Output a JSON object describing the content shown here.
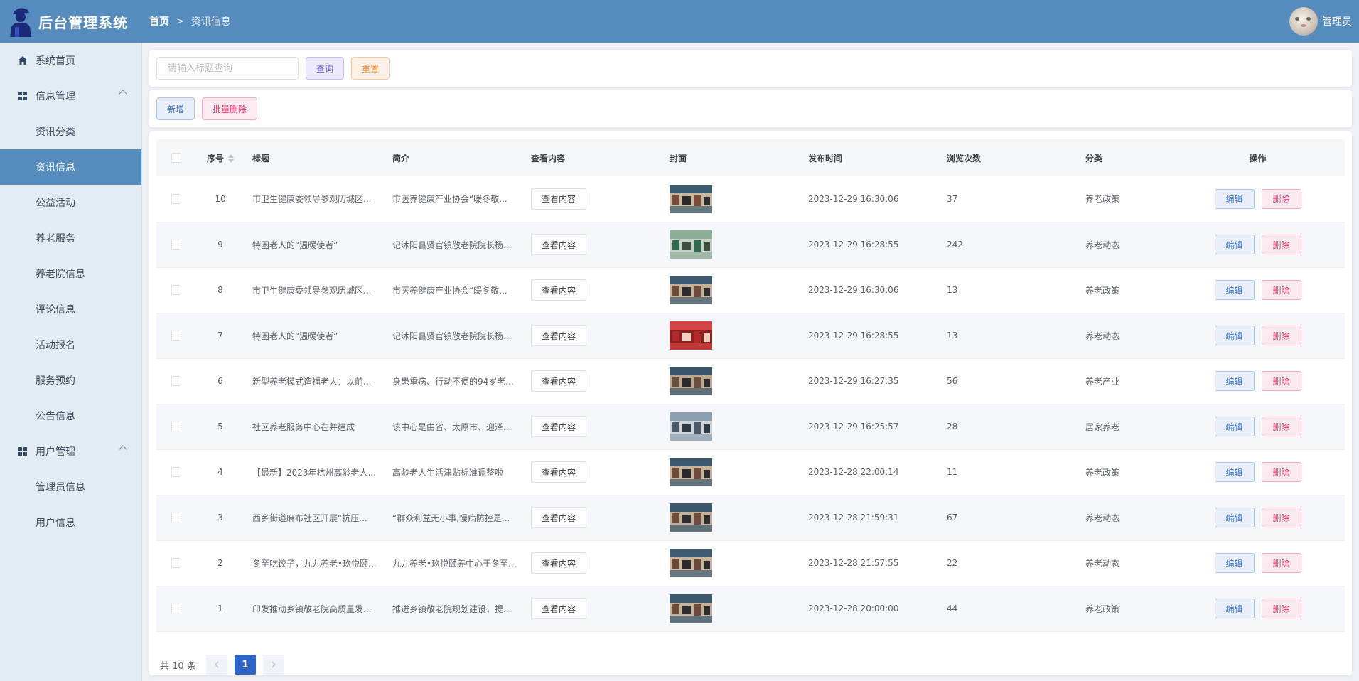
{
  "app": {
    "title": "后台管理系统"
  },
  "breadcrumb": {
    "home": "首页",
    "separator": ">",
    "current": "资讯信息"
  },
  "user": {
    "name": "管理员"
  },
  "sidebar": {
    "items": [
      {
        "label": "系统首页",
        "icon": "home-icon",
        "type": "top"
      },
      {
        "label": "信息管理",
        "icon": "grid-icon",
        "type": "group"
      },
      {
        "label": "资讯分类",
        "type": "sub"
      },
      {
        "label": "资讯信息",
        "type": "sub",
        "active": true
      },
      {
        "label": "公益活动",
        "type": "sub"
      },
      {
        "label": "养老服务",
        "type": "sub"
      },
      {
        "label": "养老院信息",
        "type": "sub"
      },
      {
        "label": "评论信息",
        "type": "sub"
      },
      {
        "label": "活动报名",
        "type": "sub"
      },
      {
        "label": "服务预约",
        "type": "sub"
      },
      {
        "label": "公告信息",
        "type": "sub"
      },
      {
        "label": "用户管理",
        "icon": "grid-icon",
        "type": "group"
      },
      {
        "label": "管理员信息",
        "type": "sub"
      },
      {
        "label": "用户信息",
        "type": "sub"
      }
    ]
  },
  "search": {
    "placeholder": "请输入标题查询",
    "value": "",
    "query_label": "查询",
    "reset_label": "重置"
  },
  "actions": {
    "add_label": "新增",
    "batch_delete_label": "批量删除"
  },
  "table": {
    "columns": [
      "序号",
      "标题",
      "简介",
      "查看内容",
      "封面",
      "发布时间",
      "浏览次数",
      "分类",
      "操作"
    ],
    "view_label": "查看内容",
    "edit_label": "编辑",
    "delete_label": "删除",
    "rows": [
      {
        "id": "10",
        "title": "市卫生健康委领导参观历城区...",
        "intro": "市医养健康产业协会“暖冬敬...",
        "time": "2023-12-29 16:30:06",
        "views": "37",
        "category": "养老政策"
      },
      {
        "id": "9",
        "title": "特困老人的“温暖使者”",
        "intro": "记沭阳县贤官镇敬老院院长杨...",
        "time": "2023-12-29 16:28:55",
        "views": "242",
        "category": "养老动态"
      },
      {
        "id": "8",
        "title": "市卫生健康委领导参观历城区...",
        "intro": "市医养健康产业协会“暖冬敬...",
        "time": "2023-12-29 16:30:06",
        "views": "13",
        "category": "养老政策"
      },
      {
        "id": "7",
        "title": "特困老人的“温暖使者”",
        "intro": "记沭阳县贤官镇敬老院院长杨...",
        "time": "2023-12-29 16:28:55",
        "views": "13",
        "category": "养老动态"
      },
      {
        "id": "6",
        "title": "新型养老模式造福老人：以前...",
        "intro": "身患重病、行动不便的94岁老...",
        "time": "2023-12-29 16:27:35",
        "views": "56",
        "category": "养老产业"
      },
      {
        "id": "5",
        "title": "社区养老服务中心在并建成",
        "intro": "该中心是由省、太原市、迎泽...",
        "time": "2023-12-29 16:25:57",
        "views": "28",
        "category": "居家养老"
      },
      {
        "id": "4",
        "title": "【最新】2023年杭州高龄老人...",
        "intro": "高龄老人生活津贴标准调整啦",
        "time": "2023-12-28 22:00:14",
        "views": "11",
        "category": "养老政策"
      },
      {
        "id": "3",
        "title": "西乡街道麻布社区开展“抗压...",
        "intro": "“群众利益无小事,慢病防控是...",
        "time": "2023-12-28 21:59:31",
        "views": "67",
        "category": "养老动态"
      },
      {
        "id": "2",
        "title": "冬至吃饺子，九九养老•玖悦颐...",
        "intro": "九九养老•玖悦颐养中心于冬至...",
        "time": "2023-12-28 21:57:55",
        "views": "22",
        "category": "养老动态"
      },
      {
        "id": "1",
        "title": "印发推动乡镇敬老院高质量发...",
        "intro": "推进乡镇敬老院规划建设，提...",
        "time": "2023-12-28 20:00:00",
        "views": "44",
        "category": "养老政策"
      }
    ]
  },
  "pagination": {
    "total_text": "共 10 条",
    "current_page": "1"
  },
  "colors": {
    "header": "#568bbd",
    "sidebar": "#e3ebf3",
    "active": "#568bbd",
    "primary": "#2d62c9"
  }
}
